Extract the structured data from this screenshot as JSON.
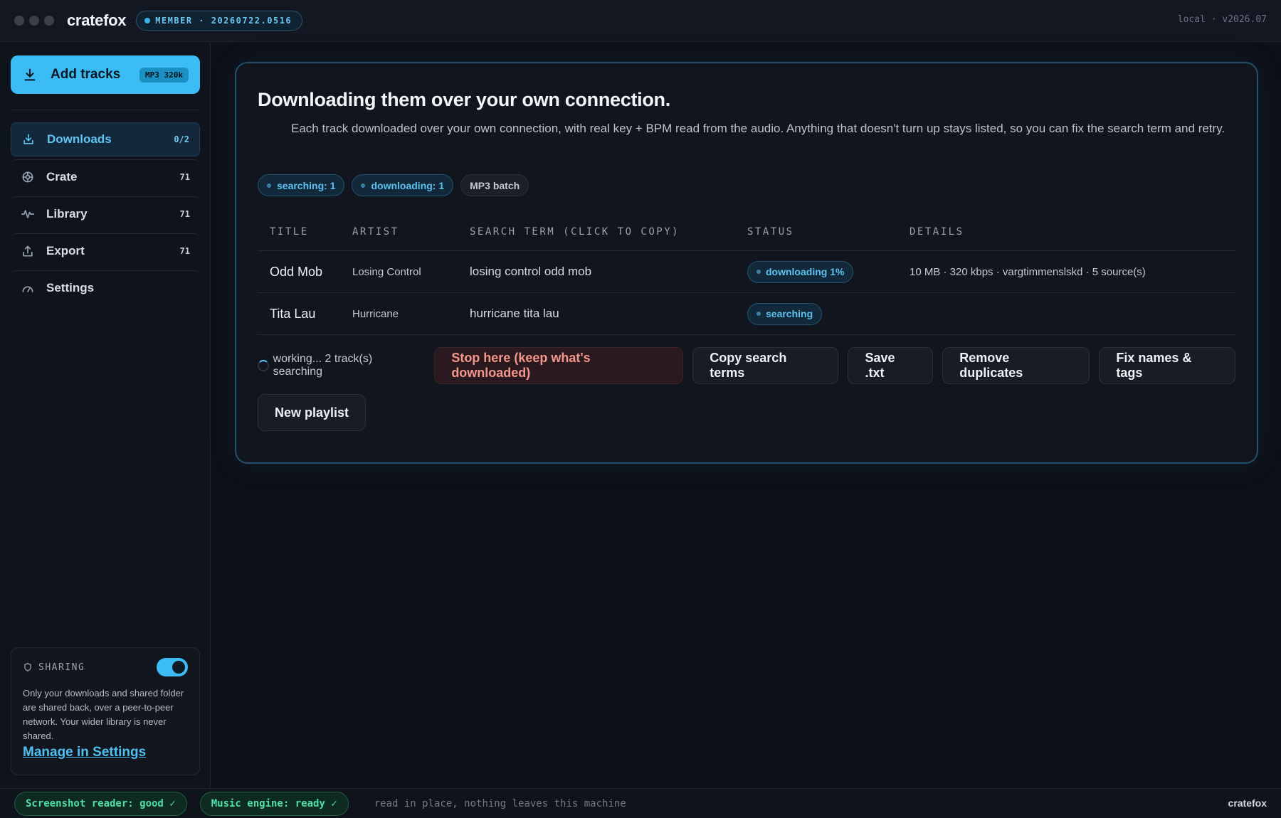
{
  "topbar": {
    "brand": "cratefox",
    "member_badge": "MEMBER · 20260722.0516",
    "version": "local · v2026.07"
  },
  "sidebar": {
    "add_button": {
      "label": "Add tracks",
      "tag": "MP3 320k",
      "icon": "download-icon"
    },
    "items": [
      {
        "label": "Downloads",
        "count": "0/2",
        "icon": "download-icon",
        "active": true
      },
      {
        "label": "Crate",
        "count": "71",
        "icon": "crate-icon"
      },
      {
        "label": "Library",
        "count": "71",
        "icon": "waveform-icon"
      },
      {
        "label": "Export",
        "count": "71",
        "icon": "upload-icon"
      },
      {
        "label": "Settings",
        "count": "",
        "icon": "gauge-icon"
      }
    ],
    "sharing": {
      "heading": "SHARING",
      "enabled": true,
      "text": "Only your downloads and shared folder are shared back, over a peer-to-peer network. Your wider library is never shared.",
      "link": "Manage in Settings"
    }
  },
  "main": {
    "title": "Downloading them over your own connection.",
    "description": "Each track downloaded over your own connection, with real key + BPM read from the audio. Anything that doesn't turn up stays listed, so you can fix the search term and retry.",
    "chips": [
      "searching: 1",
      "downloading: 1",
      "MP3 batch"
    ],
    "table": {
      "headers": [
        "TITLE",
        "ARTIST",
        "SEARCH TERM (CLICK TO COPY)",
        "STATUS",
        "DETAILS"
      ],
      "rows": [
        {
          "title": "Odd Mob",
          "artist": "Losing Control",
          "search": "losing control odd mob",
          "status": "downloading 1%",
          "details": "10 MB · 320 kbps · vargtimmenslskd · 5 source(s)"
        },
        {
          "title": "Tita Lau",
          "artist": "Hurricane",
          "search": "hurricane tita lau",
          "status": "searching",
          "details": ""
        }
      ]
    },
    "working_text": "working... 2 track(s) searching",
    "buttons": {
      "stop": "Stop here (keep what's downloaded)",
      "copy": "Copy search terms",
      "save": "Save .txt",
      "dedupe": "Remove duplicates",
      "fix": "Fix names & tags",
      "new_playlist": "New playlist"
    }
  },
  "statusbar": {
    "reader": "Screenshot reader: good ✓",
    "engine": "Music engine: ready ✓",
    "note": "read in place, nothing leaves this machine",
    "brand": "cratefox"
  },
  "colors": {
    "accent": "#3cbcf4",
    "danger_text": "#f4968c",
    "ok": "#4fe0a6"
  }
}
